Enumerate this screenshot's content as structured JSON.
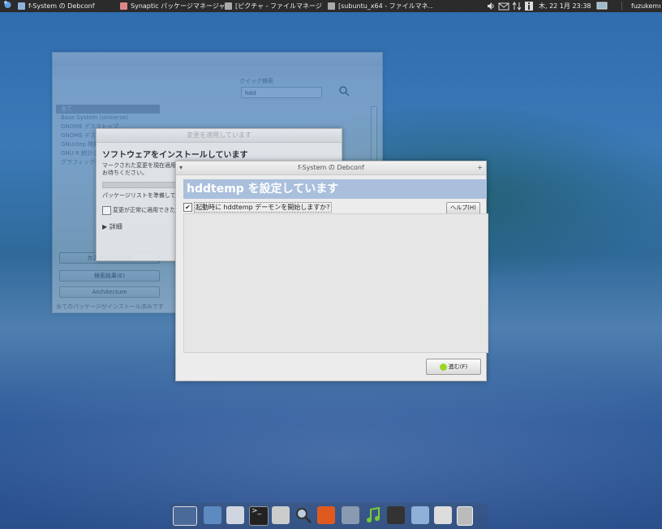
{
  "top_panel": {
    "tasks": [
      {
        "label": "f-System の Debconf"
      },
      {
        "label": "Synaptic パッケージマネージャ"
      },
      {
        "label": "[ピクチャ - ファイルマネージャ]"
      },
      {
        "label": "[subuntu_x64 - ファイルマネ..."
      }
    ],
    "clock": "木, 22 1月 23:38",
    "user": "fuzukemn",
    "tray_icons": [
      "volume-icon",
      "mail-icon",
      "network-icon",
      "info-icon",
      "display-icon"
    ]
  },
  "synaptic": {
    "search_label": "クイック検索",
    "search_value": "hdd",
    "list_items": [
      "全て",
      "Base System (universe)",
      "GNOME デスクトップ",
      "GNOME デスクトップ",
      "GNUstep 開発",
      "GNU R 統計システム",
      "グラフィック環境"
    ],
    "button_custom": "カスタムフィルタ",
    "button_search_results": "検索結果(E)",
    "button_architecture": "Architecture",
    "status": "全てのパッケージがインストール済みです"
  },
  "install_dialog": {
    "title": "変更を適用しています",
    "heading": "ソフトウェアをインストールしています",
    "text_line1": "マークされた変更を現在適用中です。",
    "text_line2": "お待ちください。",
    "progress": 0.45,
    "progress_label": "パッケージリストを準備しています...",
    "close_option": "変更が正常に適用できたら閉じる",
    "details": "▶ 詳細"
  },
  "debconf": {
    "title": "f-System の Debconf",
    "heading": "hddtemp を設定しています",
    "question": "起動時に hddtemp デーモンを開始しますか?",
    "checked": true,
    "help_button": "ヘルプ(H)",
    "next_button": "進む(F)"
  },
  "dock": {
    "icons": [
      "desktop-icon",
      "pointer-app-icon",
      "files-icon",
      "terminal-icon",
      "tools-icon",
      "search-icon",
      "software-center-icon",
      "editor-icon",
      "music-icon",
      "video-icon",
      "folder-icon",
      "camera-icon",
      "trash-icon"
    ]
  },
  "colors": {
    "accent": "#a9bfdc",
    "panel": "#2b2b2b"
  }
}
